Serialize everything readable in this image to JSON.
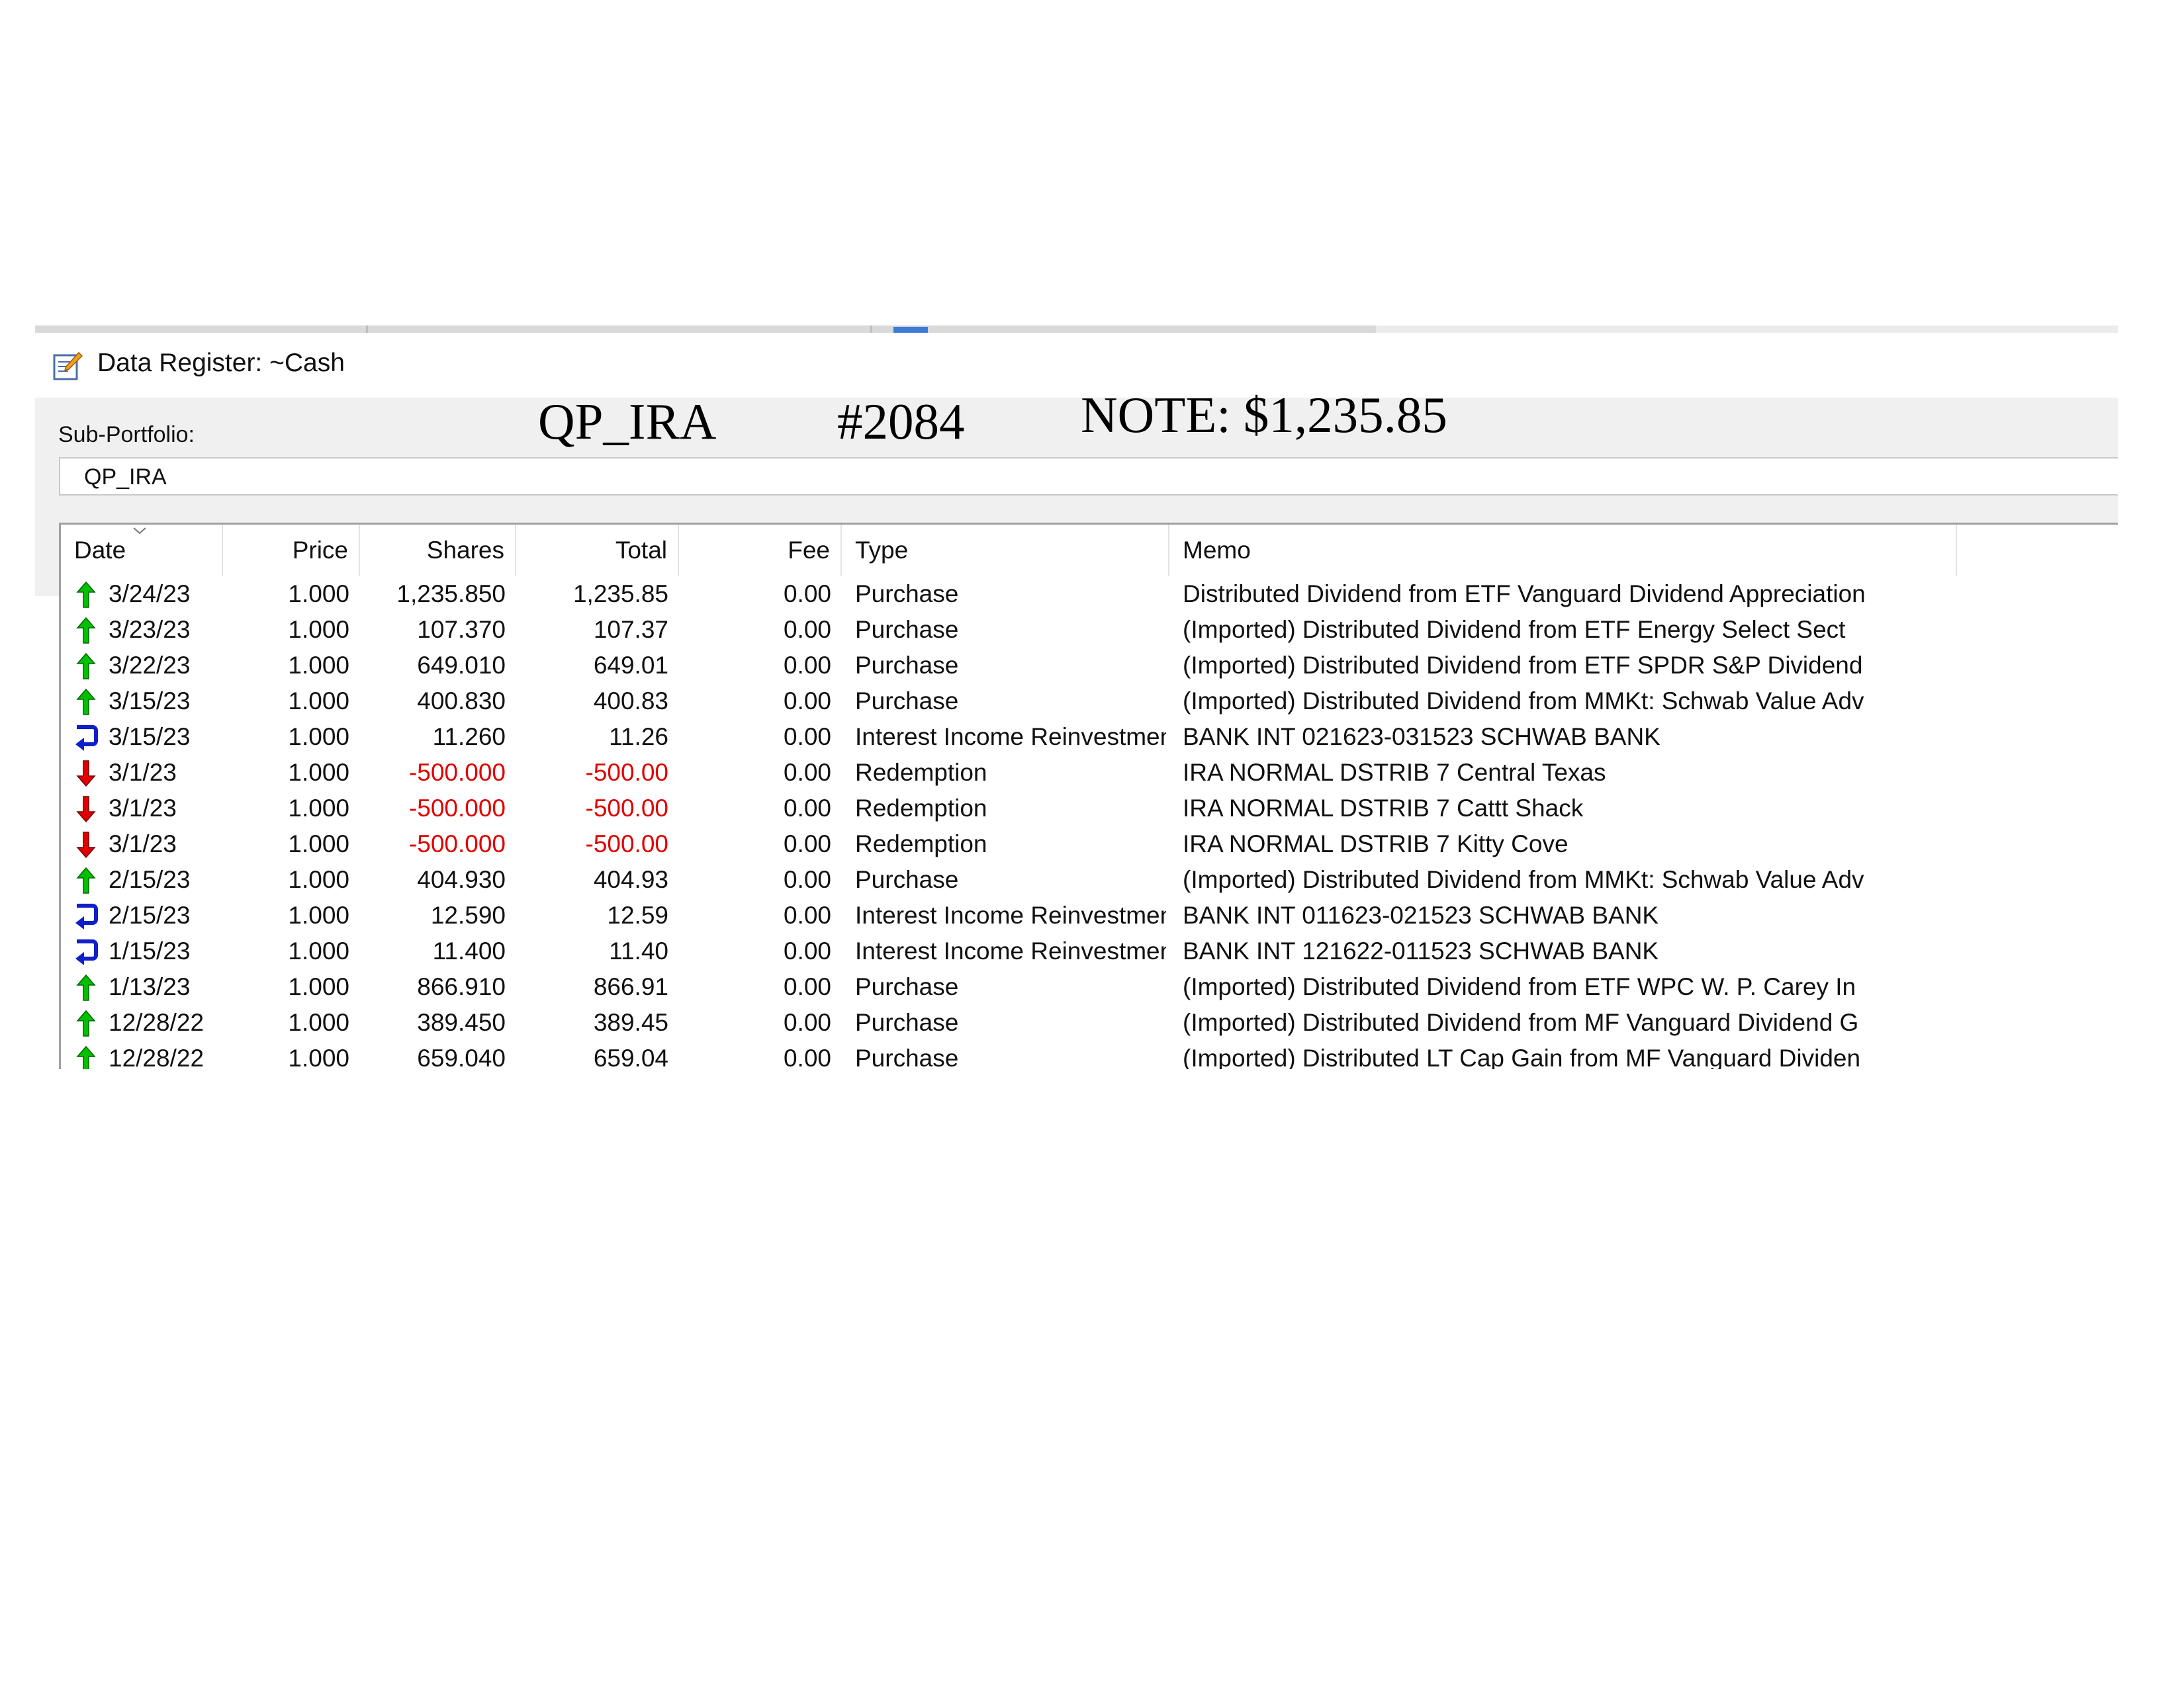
{
  "window": {
    "title": "Data Register: ~Cash"
  },
  "sub_portfolio": {
    "label": "Sub-Portfolio:",
    "value": "QP_IRA"
  },
  "annotations": {
    "portfolio": "QP_IRA",
    "account": "#2084",
    "note": "NOTE: $1,235.85"
  },
  "columns": {
    "date": "Date",
    "price": "Price",
    "shares": "Shares",
    "total": "Total",
    "fee": "Fee",
    "type": "Type",
    "memo": "Memo"
  },
  "colors": {
    "purchase_icon": "#00c000",
    "redemption_icon": "#e00000",
    "reinvest_icon": "#1020c8",
    "negative_text": "#e00000"
  },
  "transactions": [
    {
      "icon": "up-arrow-icon",
      "date": "3/24/23",
      "price": "1.000",
      "shares": "1,235.850",
      "total": "1,235.85",
      "fee": "0.00",
      "type": "Purchase",
      "memo": "Distributed Dividend from ETF Vanguard Dividend Appreciation",
      "negative": false
    },
    {
      "icon": "up-arrow-icon",
      "date": "3/23/23",
      "price": "1.000",
      "shares": "107.370",
      "total": "107.37",
      "fee": "0.00",
      "type": "Purchase",
      "memo": "(Imported) Distributed Dividend from ETF Energy Select Sect",
      "negative": false
    },
    {
      "icon": "up-arrow-icon",
      "date": "3/22/23",
      "price": "1.000",
      "shares": "649.010",
      "total": "649.01",
      "fee": "0.00",
      "type": "Purchase",
      "memo": "(Imported) Distributed Dividend from ETF SPDR S&P Dividend",
      "negative": false
    },
    {
      "icon": "up-arrow-icon",
      "date": "3/15/23",
      "price": "1.000",
      "shares": "400.830",
      "total": "400.83",
      "fee": "0.00",
      "type": "Purchase",
      "memo": "(Imported) Distributed Dividend from MMKt: Schwab Value Adv",
      "negative": false
    },
    {
      "icon": "reinvest-arrow-icon",
      "date": "3/15/23",
      "price": "1.000",
      "shares": "11.260",
      "total": "11.26",
      "fee": "0.00",
      "type": "Interest Income Reinvestment",
      "memo": "BANK INT 021623-031523 SCHWAB BANK",
      "negative": false
    },
    {
      "icon": "down-arrow-icon",
      "date": "3/1/23",
      "price": "1.000",
      "shares": "-500.000",
      "total": "-500.00",
      "fee": "0.00",
      "type": "Redemption",
      "memo": "IRA NORMAL DSTRIB 7 Central Texas",
      "negative": true
    },
    {
      "icon": "down-arrow-icon",
      "date": "3/1/23",
      "price": "1.000",
      "shares": "-500.000",
      "total": "-500.00",
      "fee": "0.00",
      "type": "Redemption",
      "memo": "IRA NORMAL DSTRIB 7 Cattt Shack",
      "negative": true
    },
    {
      "icon": "down-arrow-icon",
      "date": "3/1/23",
      "price": "1.000",
      "shares": "-500.000",
      "total": "-500.00",
      "fee": "0.00",
      "type": "Redemption",
      "memo": "IRA NORMAL DSTRIB 7 Kitty Cove",
      "negative": true
    },
    {
      "icon": "up-arrow-icon",
      "date": "2/15/23",
      "price": "1.000",
      "shares": "404.930",
      "total": "404.93",
      "fee": "0.00",
      "type": "Purchase",
      "memo": "(Imported) Distributed Dividend from MMKt: Schwab Value Adv",
      "negative": false
    },
    {
      "icon": "reinvest-arrow-icon",
      "date": "2/15/23",
      "price": "1.000",
      "shares": "12.590",
      "total": "12.59",
      "fee": "0.00",
      "type": "Interest Income Reinvestment",
      "memo": "BANK INT 011623-021523 SCHWAB BANK",
      "negative": false
    },
    {
      "icon": "reinvest-arrow-icon",
      "date": "1/15/23",
      "price": "1.000",
      "shares": "11.400",
      "total": "11.40",
      "fee": "0.00",
      "type": "Interest Income Reinvestment",
      "memo": "BANK INT 121622-011523 SCHWAB BANK",
      "negative": false
    },
    {
      "icon": "up-arrow-icon",
      "date": "1/13/23",
      "price": "1.000",
      "shares": "866.910",
      "total": "866.91",
      "fee": "0.00",
      "type": "Purchase",
      "memo": "(Imported) Distributed Dividend from ETF WPC W. P. Carey In",
      "negative": false
    },
    {
      "icon": "up-arrow-icon",
      "date": "12/28/22",
      "price": "1.000",
      "shares": "389.450",
      "total": "389.45",
      "fee": "0.00",
      "type": "Purchase",
      "memo": "(Imported) Distributed Dividend from MF Vanguard Dividend G",
      "negative": false
    },
    {
      "icon": "up-arrow-icon",
      "date": "12/28/22",
      "price": "1.000",
      "shares": "659.040",
      "total": "659.04",
      "fee": "0.00",
      "type": "Purchase",
      "memo": "(Imported) Distributed LT Cap Gain from MF Vanguard Dividen",
      "negative": false
    }
  ]
}
